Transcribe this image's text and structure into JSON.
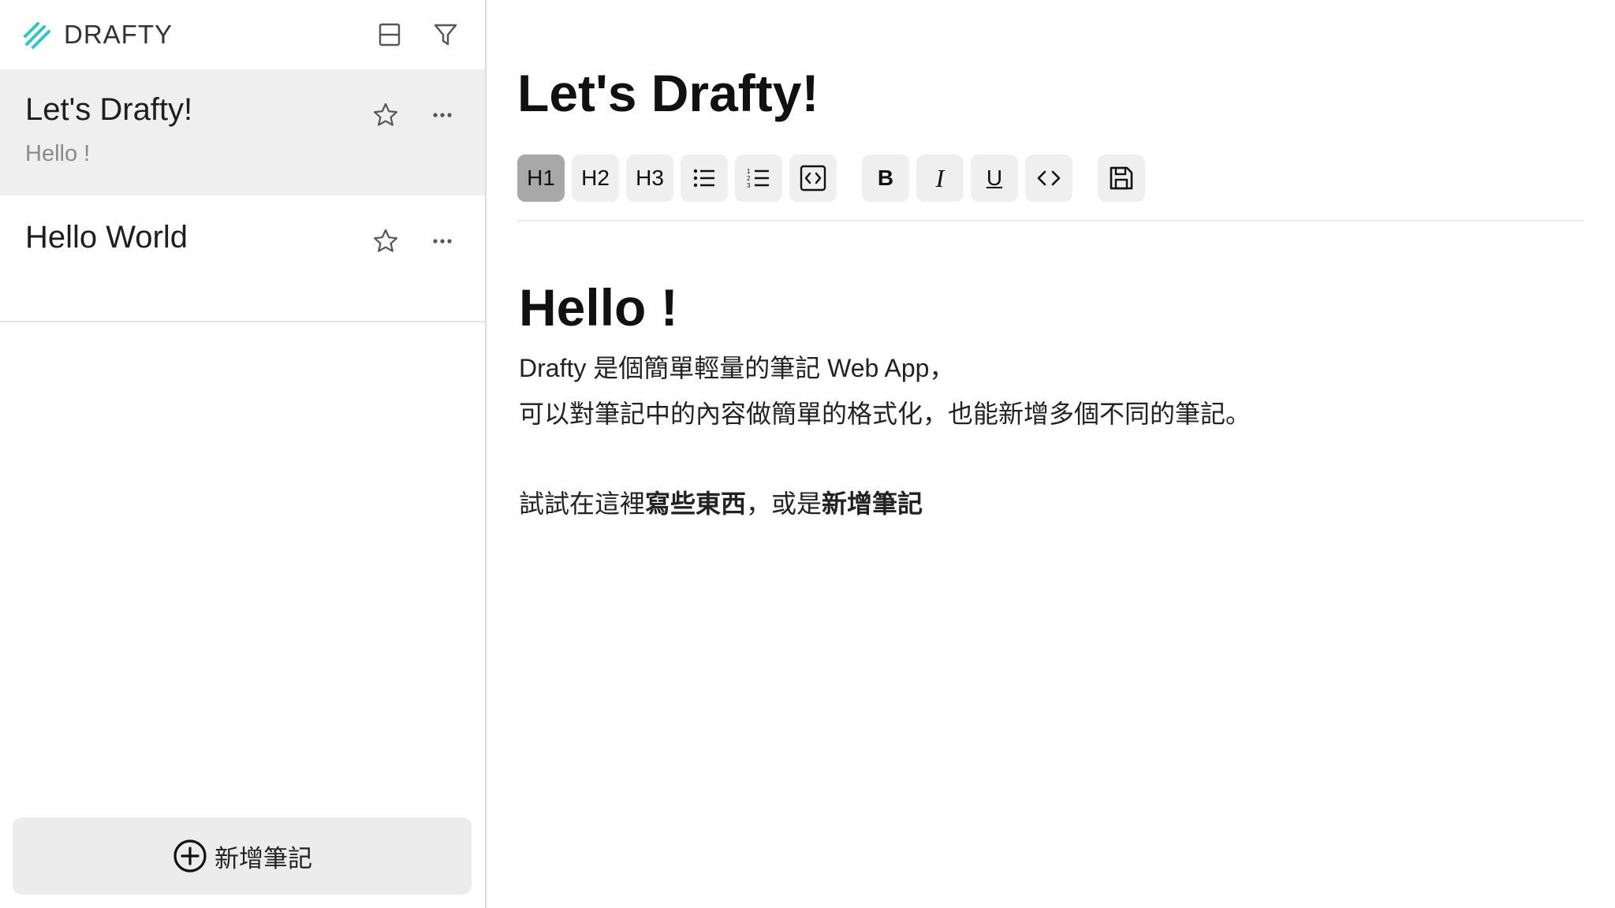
{
  "brand": {
    "name": "DRAFTY",
    "accent": "#2fc6c6"
  },
  "header_icons": [
    "layout-icon",
    "filter-icon"
  ],
  "notes": [
    {
      "title": "Let's Drafty!",
      "preview": "Hello !",
      "active": true
    },
    {
      "title": "Hello World",
      "preview": "",
      "active": false
    }
  ],
  "add_note_label": "新增筆記",
  "editor": {
    "title": "Let's Drafty!",
    "toolbar": {
      "h1": "H1",
      "h2": "H2",
      "h3": "H3",
      "bold": "B",
      "italic": "I",
      "underline": "U",
      "active": "H1"
    },
    "content": {
      "heading": "Hello !",
      "line1": "Drafty 是個簡單輕量的筆記 Web App，",
      "line2": "可以對筆記中的內容做簡單的格式化，也能新增多個不同的筆記。",
      "line3_a": "試試在這裡",
      "line3_b": "寫些東西",
      "line3_c": "，或是",
      "line3_d": "新增筆記"
    }
  }
}
